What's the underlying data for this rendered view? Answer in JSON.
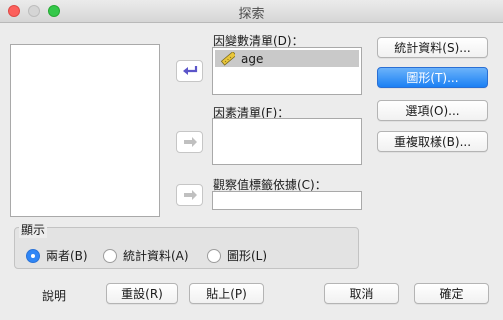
{
  "window": {
    "title": "探索"
  },
  "source_list": {
    "items": []
  },
  "dependent": {
    "label": "因變數清單(D)：",
    "items": [
      {
        "name": "age",
        "icon": "ruler-icon"
      }
    ]
  },
  "factor": {
    "label": "因素清單(F)："
  },
  "label_cases": {
    "label": "觀察值標籤依據(C)：",
    "value": ""
  },
  "side_buttons": {
    "statistics": "統計資料(S)...",
    "plots": "圖形(T)...",
    "options": "選項(O)...",
    "bootstrap": "重複取樣(B)..."
  },
  "display": {
    "title": "顯示",
    "options": [
      {
        "label": "兩者(B)",
        "selected": true
      },
      {
        "label": "統計資料(A)",
        "selected": false
      },
      {
        "label": "圖形(L)",
        "selected": false
      }
    ]
  },
  "bottom_buttons": {
    "help": "說明",
    "reset": "重設(R)",
    "paste": "貼上(P)",
    "cancel": "取消",
    "ok": "確定"
  },
  "colors": {
    "accent": "#2f86f6",
    "selection": "#c9c9c9",
    "arrow_active": "#5b55c9",
    "arrow_inactive": "#c0c0c0"
  }
}
